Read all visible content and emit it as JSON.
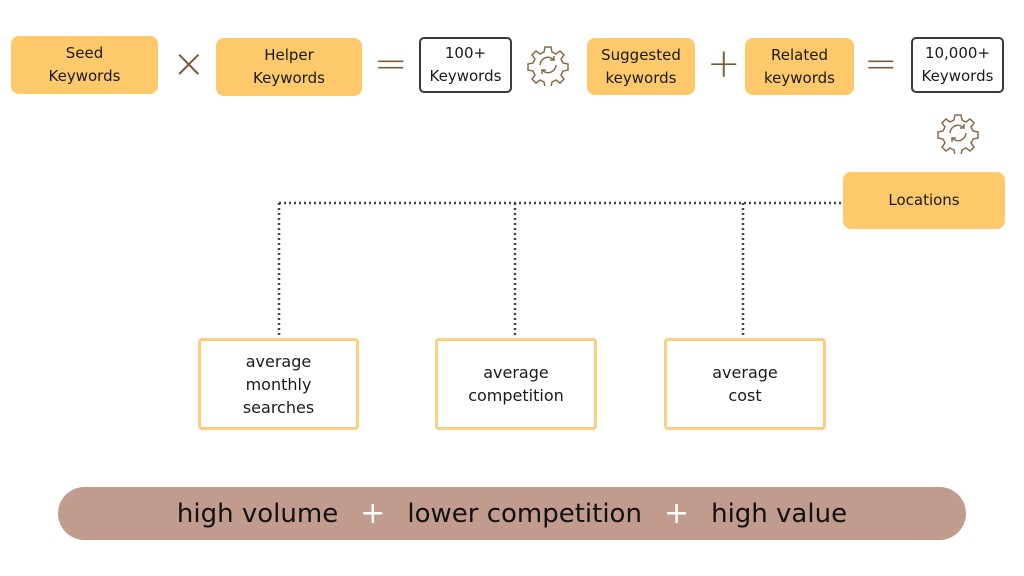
{
  "top_row": {
    "seed": [
      "Seed",
      "Keywords"
    ],
    "times": "×",
    "helper": [
      "Helper",
      "Keywords"
    ],
    "equals": "=",
    "result1": [
      "100+",
      "Keywords"
    ],
    "suggested": [
      "Suggested",
      "keywords"
    ],
    "plus": "+",
    "related": [
      "Related",
      "keywords"
    ],
    "result2": [
      "10,000+",
      "Keywords"
    ]
  },
  "icons": {
    "process": "gear-refresh-icon"
  },
  "locations": "Locations",
  "metrics": [
    [
      "average",
      "monthly",
      "searches"
    ],
    [
      "average",
      "competition"
    ],
    [
      "average",
      "cost"
    ]
  ],
  "summary": {
    "a": "high volume",
    "b": "lower competition",
    "c": "high value",
    "plus": "+"
  },
  "colors": {
    "box": "#fdc96b",
    "operator": "#7a5c3a",
    "pill": "#c19b8e",
    "outline": "#f8d07f"
  }
}
